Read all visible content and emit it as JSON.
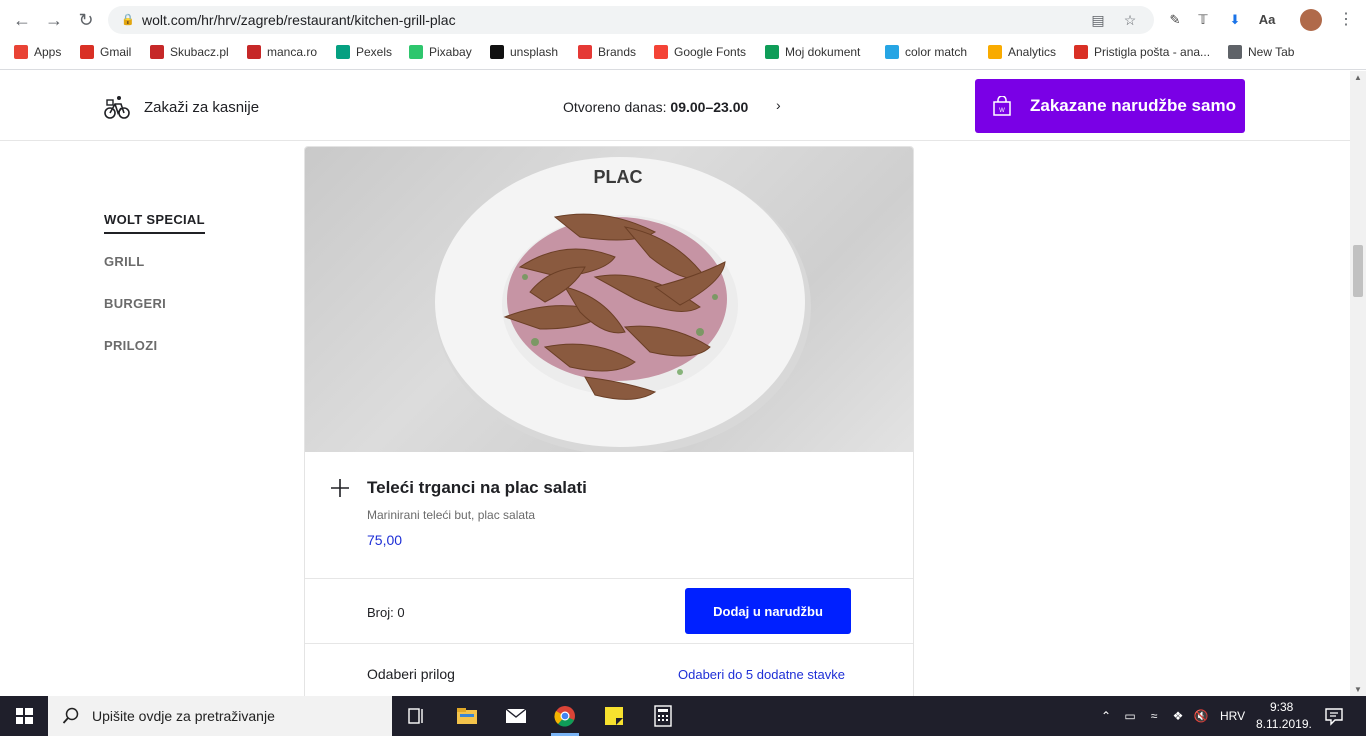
{
  "browser": {
    "url": "wolt.com/hr/hrv/zagreb/restaurant/kitchen-grill-plac",
    "bookmarks": [
      {
        "label": "Apps",
        "icon": "apps-grid-icon",
        "color": "#e94335"
      },
      {
        "label": "Gmail",
        "icon": "gmail-icon",
        "color": "#d93025"
      },
      {
        "label": "Skubacz.pl",
        "icon": "skubacz-icon",
        "color": "#c62828"
      },
      {
        "label": "manca.ro",
        "icon": "manca-icon",
        "color": "#c62828"
      },
      {
        "label": "Pexels",
        "icon": "pexels-icon",
        "color": "#05a081"
      },
      {
        "label": "Pixabay",
        "icon": "pixabay-icon",
        "color": "#2ec66d"
      },
      {
        "label": "unsplash",
        "icon": "unsplash-icon",
        "color": "#111111"
      },
      {
        "label": "Brands",
        "icon": "brands-icon",
        "color": "#e53935"
      },
      {
        "label": "Google Fonts",
        "icon": "google-fonts-icon",
        "color": "#f44336"
      },
      {
        "label": "Moj dokument",
        "icon": "sheets-icon",
        "color": "#0f9d58"
      },
      {
        "label": "color match",
        "icon": "color-match-icon",
        "color": "#26a5e4"
      },
      {
        "label": "Analytics",
        "icon": "analytics-icon",
        "color": "#f9ab00"
      },
      {
        "label": "Pristigla pošta - ana...",
        "icon": "gmail-icon",
        "color": "#d93025"
      },
      {
        "label": "New Tab",
        "icon": "globe-icon",
        "color": "#5f6368"
      }
    ]
  },
  "header": {
    "schedule_label": "Zakaži za kasnije",
    "hours_prefix": "Otvoreno danas:",
    "hours_value": "09.00–23.00",
    "cta_label": "Zakazane narudžbe samo",
    "cta_color": "#7a00e6"
  },
  "categories": [
    {
      "label": "WOLT SPECIAL",
      "active": true
    },
    {
      "label": "GRILL",
      "active": false
    },
    {
      "label": "BURGERI",
      "active": false
    },
    {
      "label": "PRILOZI",
      "active": false
    }
  ],
  "item": {
    "name": "Teleći trganci na plac salati",
    "description": "Marinirani teleći but, plac salata",
    "price": "75,00",
    "quantity_label": "Broj: 0",
    "add_button": "Dodaj u narudžbu",
    "add_button_color": "#0020ff",
    "options_label": "Odaberi prilog",
    "options_hint": "Odaberi do 5 dodatne stavke",
    "plate_brand": "PLAC"
  },
  "taskbar": {
    "search_placeholder": "Upišite ovdje za pretraživanje",
    "language": "HRV",
    "time": "9:38",
    "date": "8.11.2019."
  }
}
